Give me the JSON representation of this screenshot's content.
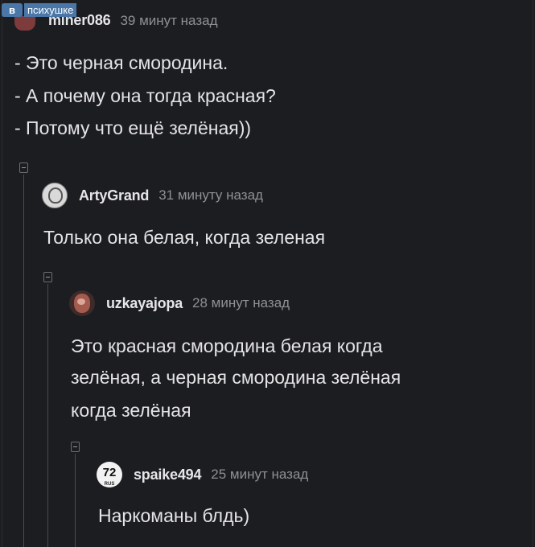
{
  "watermark": {
    "brand": "в",
    "name": "психушке"
  },
  "comments": [
    {
      "author": "miner086",
      "time": "39 минут назад",
      "lines": [
        "- Это черная смородина.",
        "- А почему она тогда красная?",
        "- Потому что ещё зелёная))"
      ]
    },
    {
      "author": "ArtyGrand",
      "time": "31 минуту назад",
      "lines": [
        "Только она белая, когда зеленая"
      ]
    },
    {
      "author": "uzkayajopa",
      "time": "28 минут назад",
      "lines": [
        "Это красная смородина белая когда",
        "зелёная, а черная смородина зелёная",
        "когда зелёная"
      ]
    },
    {
      "author": "spaike494",
      "time": "25 минут назад",
      "avatar_text": "72",
      "avatar_sub": "RUS",
      "lines": [
        "Наркоманы блдь)"
      ]
    }
  ]
}
